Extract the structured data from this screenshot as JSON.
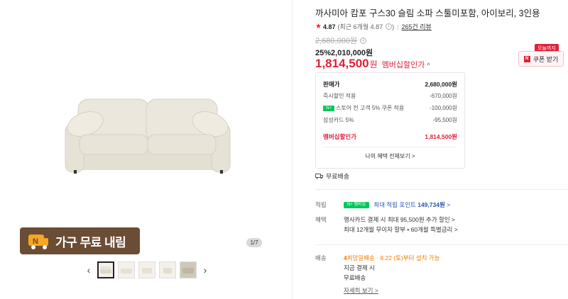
{
  "gallery": {
    "promo_badge": "가구 무료 내림",
    "page_counter": "1/7",
    "prev_icon": "chevron-left-icon",
    "next_icon": "chevron-right-icon"
  },
  "product": {
    "title": "까사미아 캄포 구스30 슬림 소파 스툴미포함, 아이보리, 3인용",
    "rating_score": "4.87",
    "rating_detail": "(최근 6개월 4.87",
    "rating_detail_end": ")",
    "review_count": "265건 리뷰",
    "original_price": "2,680,000원",
    "discount_rate": "25%",
    "sale_price": "2,010,000원",
    "member_price": "1,814,500",
    "won": "원",
    "member_label": "멤버십할인가",
    "caret": "^"
  },
  "coupon": {
    "today_tag": "오늘까지",
    "button_label": "쿠폰 받기"
  },
  "breakdown": {
    "rows": [
      {
        "label": "판매가",
        "value": "2,680,000원"
      },
      {
        "label": "즉시할인 적용",
        "value": "-670,000원"
      },
      {
        "label": "스토어 전 고객 5% 쿠폰 적용",
        "value": "-100,000원"
      },
      {
        "label": "삼성카드 5%",
        "value": "-95,500원"
      }
    ],
    "member_row": {
      "label": "멤버십할인가",
      "value": "1,814,500원"
    },
    "all_benefits": "나의 혜택 전체보기 >"
  },
  "shipping_top": "무료배송",
  "points": {
    "label": "적립",
    "text": "최대 적립 포인트",
    "amount": "149,734원",
    "arrow": ">"
  },
  "benefits": {
    "label": "혜택",
    "line1": "행사카드 결제 시 최대 95,500원 추가 할인 >",
    "line2": "최대 12개월 무이자 할부 • 60개월 특별금리 >"
  },
  "delivery": {
    "label": "배송",
    "today": "희망일배송 · 8.22 (토)부터 설치 가능",
    "line2": "지금 결제 시",
    "line3": "무료배송",
    "detail": "자세히 보기 >"
  },
  "colors": {
    "accent_red": "#e0203a",
    "naver_green": "#03c75a",
    "promo_brown": "#6b4c35",
    "link_blue": "#2b55b3"
  }
}
